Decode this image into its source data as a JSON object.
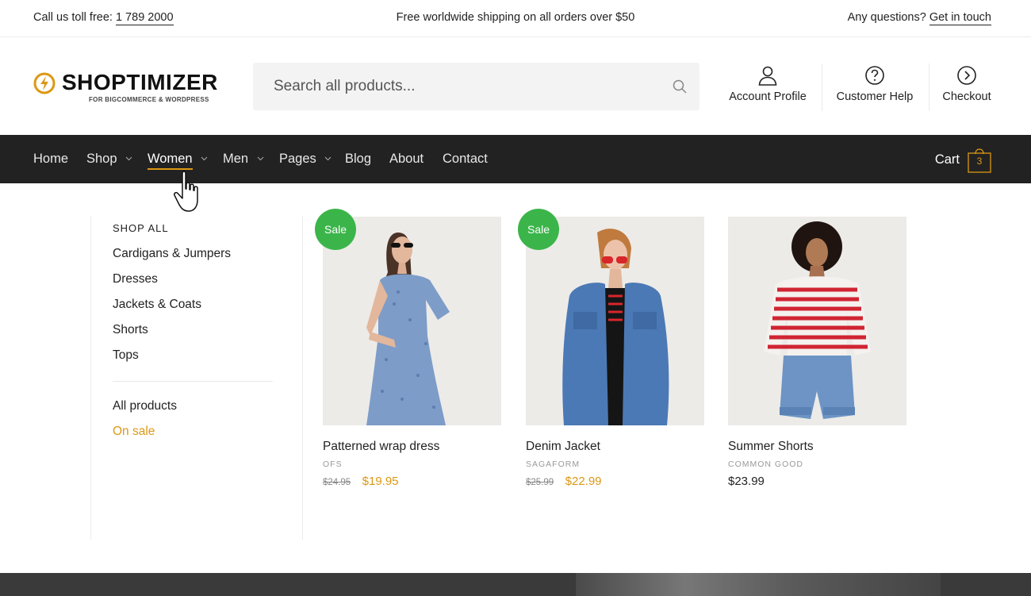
{
  "topbar": {
    "call_prefix": "Call us toll free:",
    "phone": "1 789 2000",
    "shipping": "Free worldwide shipping on all orders over $50",
    "questions_prefix": "Any questions?",
    "get_in_touch": "Get in touch"
  },
  "header": {
    "logo_word": "SHOPTIMIZER",
    "logo_tag": "FOR BIGCOMMERCE & WORDPRESS",
    "search_placeholder": "Search all products...",
    "links": {
      "account": "Account Profile",
      "help": "Customer Help",
      "checkout": "Checkout"
    }
  },
  "nav": {
    "items": [
      {
        "label": "Home"
      },
      {
        "label": "Shop"
      },
      {
        "label": "Women"
      },
      {
        "label": "Men"
      },
      {
        "label": "Pages"
      },
      {
        "label": "Blog"
      },
      {
        "label": "About"
      },
      {
        "label": "Contact"
      }
    ],
    "cart_label": "Cart",
    "cart_count": "3"
  },
  "mega": {
    "heading": "SHOP ALL",
    "categories": [
      "Cardigans & Jumpers",
      "Dresses",
      "Jackets & Coats",
      "Shorts",
      "Tops"
    ],
    "all_products": "All products",
    "on_sale": "On sale"
  },
  "products": [
    {
      "badge": "Sale",
      "title": "Patterned wrap dress",
      "brand": "OFS",
      "old_price": "$24.95",
      "price": "$19.95"
    },
    {
      "badge": "Sale",
      "title": "Denim Jacket",
      "brand": "SAGAFORM",
      "old_price": "$25.99",
      "price": "$22.99"
    },
    {
      "badge": "",
      "title": "Summer Shorts",
      "brand": "COMMON GOOD",
      "old_price": "",
      "price": "$23.99"
    }
  ],
  "colors": {
    "accent": "#dc9814",
    "nav_bg": "#222222",
    "sale_badge": "#3bb54a"
  }
}
